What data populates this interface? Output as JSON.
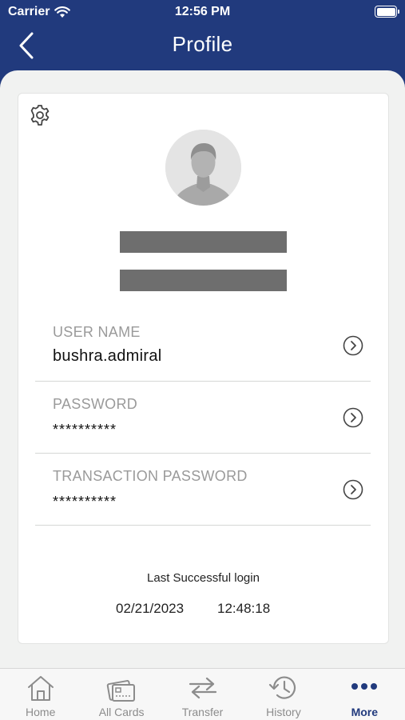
{
  "status_bar": {
    "carrier": "Carrier",
    "time": "12:56 PM"
  },
  "header": {
    "title": "Profile",
    "background": "#213a7d"
  },
  "profile": {
    "username_label": "USER NAME",
    "username_value": "bushra.admiral",
    "password_label": "PASSWORD",
    "password_value": "**********",
    "txn_password_label": "TRANSACTION PASSWORD",
    "txn_password_value": "**********",
    "last_login_label": "Last Successful login",
    "last_login_date": "02/21/2023",
    "last_login_time": "12:48:18"
  },
  "tabs": [
    {
      "label": "Home",
      "icon": "home-icon"
    },
    {
      "label": "All Cards",
      "icon": "cards-icon"
    },
    {
      "label": "Transfer",
      "icon": "transfer-icon"
    },
    {
      "label": "History",
      "icon": "history-icon"
    },
    {
      "label": "More",
      "icon": "more-icon",
      "active": true
    }
  ]
}
